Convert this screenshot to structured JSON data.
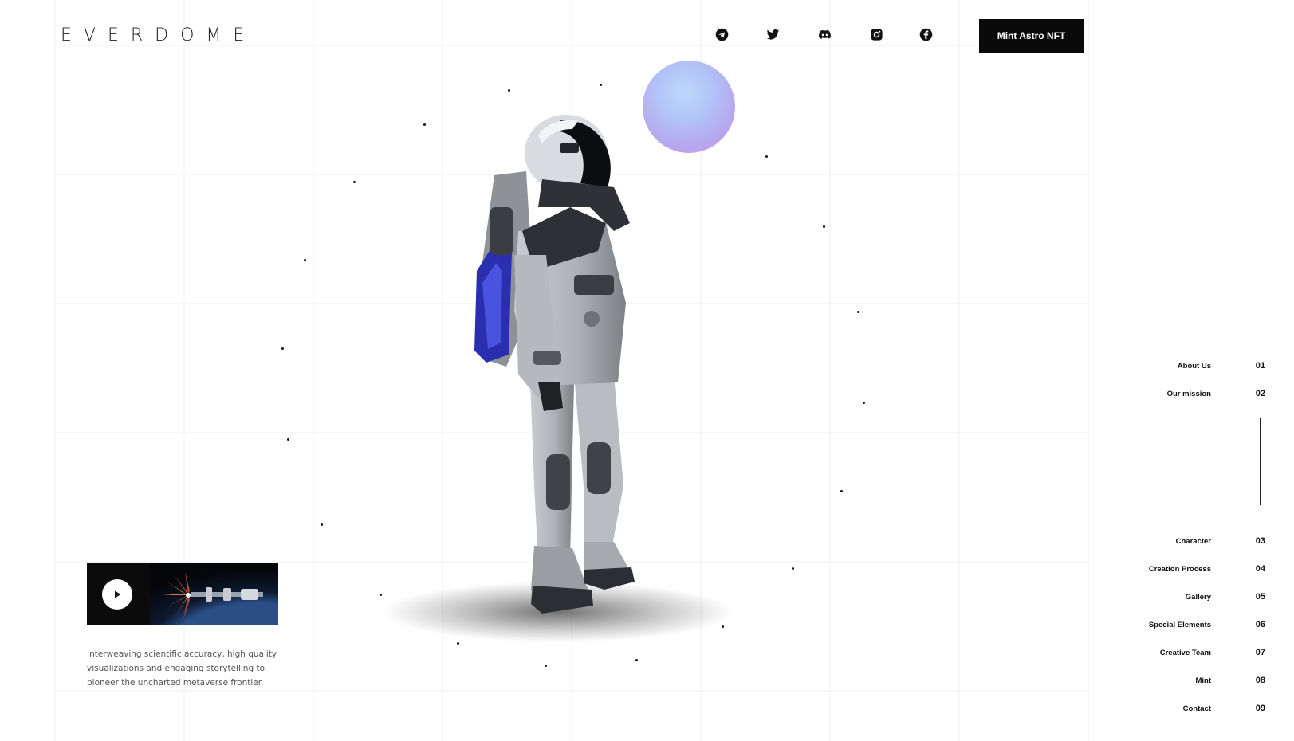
{
  "header": {
    "logo": "EVERDOME",
    "social": [
      {
        "name": "telegram-icon"
      },
      {
        "name": "twitter-icon"
      },
      {
        "name": "discord-icon"
      },
      {
        "name": "instagram-icon"
      },
      {
        "name": "facebook-icon"
      }
    ],
    "mint_label": "Mint Astro NFT"
  },
  "video": {
    "play_icon": "play-icon",
    "description": "Interweaving scientific accuracy, high quality visualizations and engaging storytelling to pioneer the uncharted metaverse frontier."
  },
  "nav": {
    "items": [
      {
        "label": "About Us",
        "num": "01"
      },
      {
        "label": "Our mission",
        "num": "02"
      },
      {
        "label": "Character",
        "num": "03"
      },
      {
        "label": "Creation Process",
        "num": "04"
      },
      {
        "label": "Gallery",
        "num": "05"
      },
      {
        "label": "Special Elements",
        "num": "06"
      },
      {
        "label": "Creative Team",
        "num": "07"
      },
      {
        "label": "Mint",
        "num": "08"
      },
      {
        "label": "Contact",
        "num": "09"
      }
    ]
  },
  "colors": {
    "background": "#ffffff",
    "button": "#0a0a0a",
    "grid": "#efefef",
    "bubble": "#b7c3f6"
  }
}
